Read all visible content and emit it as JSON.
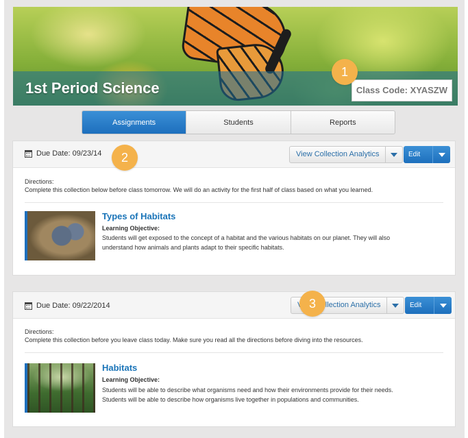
{
  "banner": {
    "title": "1st Period Science",
    "class_code": "Class Code: XYASZW"
  },
  "tabs": [
    {
      "label": "Assignments",
      "active": true
    },
    {
      "label": "Students",
      "active": false
    },
    {
      "label": "Reports",
      "active": false
    }
  ],
  "assignments": [
    {
      "due_date": "Due Date: 09/23/14",
      "analytics_label": "View Collection Analytics",
      "edit_label": "Edit",
      "directions_label": "Directions:",
      "directions": "Complete this collection below before class tomorrow. We will do an activity for the first half of class based on what you learned.",
      "item_title": "Types of Habitats",
      "learning_objective_label": "Learning Objective:",
      "learning_objective_lines": [
        "Students will get exposed to the concept of a habitat and the various habitats on our planet. They will also",
        "understand how animals and plants adapt to their specific habitats."
      ]
    },
    {
      "due_date": "Due Date: 09/22/2014",
      "analytics_label": "View Collection Analytics",
      "edit_label": "Edit",
      "directions_label": "Directions:",
      "directions": "Complete this collection before you leave class today. Make sure you read all the directions before diving into the resources.",
      "item_title": "Habitats",
      "learning_objective_label": "Learning Objective:",
      "learning_objective_lines": [
        "Students will be able to describe what organisms need and how their environments provide for their needs.",
        "Students will be able to describe how organisms live together in populations and communities."
      ]
    }
  ],
  "callouts": [
    "1",
    "2",
    "3"
  ],
  "colors": {
    "accent": "#1d6fbd",
    "badge": "#f4b24b",
    "link": "#1a74b8"
  }
}
